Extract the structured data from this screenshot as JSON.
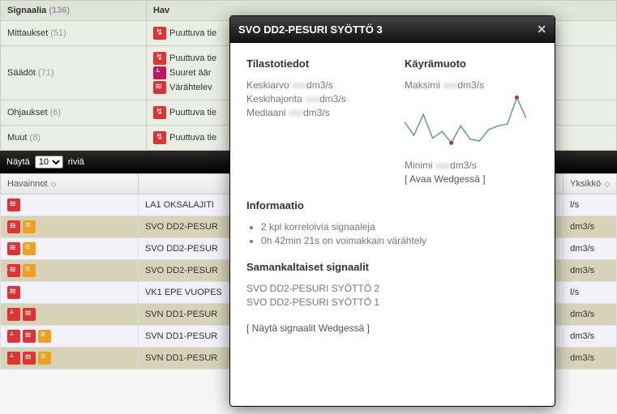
{
  "summary": {
    "header1": "Signaalia",
    "header1_count": "(136)",
    "header2": "Hav",
    "rows": [
      {
        "label": "Mittaukset",
        "count": "(51)",
        "obs": [
          {
            "icon": "warn-red",
            "text": "Puuttuva tie"
          }
        ]
      },
      {
        "label": "Säädöt",
        "count": "(71)",
        "obs": [
          {
            "icon": "warn-red",
            "text": "Puuttuva tie"
          },
          {
            "icon": "pulse-magenta",
            "text": "Suuret äär"
          },
          {
            "icon": "vibrate-red",
            "text": "Värähtelev"
          }
        ]
      },
      {
        "label": "Ohjaukset",
        "count": "(6)",
        "obs": [
          {
            "icon": "warn-red",
            "text": "Puuttuva tie"
          }
        ]
      },
      {
        "label": "Muut",
        "count": "(8)",
        "obs": [
          {
            "icon": "warn-red",
            "text": "Puuttuva tie"
          }
        ]
      }
    ]
  },
  "toolbar": {
    "show_label": "Näytä",
    "rows_label": "riviä",
    "select_value": "10"
  },
  "table": {
    "col_havainnot": "Havainnot",
    "col_yksikko": "Yksikkö",
    "rows": [
      {
        "icons": [
          "vibrate-red"
        ],
        "name": "LA1 OKSALAJITI",
        "unit": "l/s"
      },
      {
        "icons": [
          "vibrate-red",
          "warn-orange"
        ],
        "name": "SVO DD2-PESUR",
        "unit": "dm3/s"
      },
      {
        "icons": [
          "vibrate-red",
          "warn-orange"
        ],
        "name": "SVO DD2-PESUR",
        "unit": "dm3/s"
      },
      {
        "icons": [
          "vibrate-red",
          "warn-orange"
        ],
        "name": "SVO DD2-PESUR",
        "unit": "dm3/s"
      },
      {
        "icons": [
          "vibrate-red"
        ],
        "name": "VK1 EPE VUOPES",
        "unit": "l/s"
      },
      {
        "icons": [
          "pulse-red",
          "vibrate-red"
        ],
        "name": "SVN DD1-PESUR",
        "unit": "dm3/s"
      },
      {
        "icons": [
          "pulse-red",
          "vibrate-red",
          "warn-orange"
        ],
        "name": "SVN DD1-PESUR",
        "unit": "dm3/s"
      },
      {
        "icons": [
          "pulse-red",
          "vibrate-red",
          "warn-orange"
        ],
        "name": "SVN DD1-PESUR",
        "unit": "dm3/s"
      }
    ]
  },
  "modal": {
    "title": "SVO DD2-PESURI SYÖTTÖ 3",
    "stats_heading": "Tilastotiedot",
    "curve_heading": "Käyrämuoto",
    "mean_label": "Keskiarvo",
    "stddev_label": "Keskihajonta",
    "median_label": "Mediaani",
    "unit": "dm3/s",
    "max_label": "Maksimi",
    "min_label": "Minimi",
    "open_wedge": "[ Avaa Wedgessä ]",
    "info_heading": "Informaatio",
    "info_items": [
      "2 kpl korreloivia signaaleja",
      "0h 42min 21s on voimakkain värähtely"
    ],
    "similar_heading": "Samankaltaiset signaalit",
    "similar_items": [
      "SVO DD2-PESURI SYÖTTÖ 2",
      "SVO DD2-PESURI SYÖTTÖ 1"
    ],
    "show_wedge": "[ Näytä signaalit Wedgessä ]"
  },
  "chart_data": {
    "type": "line",
    "title": "",
    "x": [
      0,
      1,
      2,
      3,
      4,
      5,
      6,
      7,
      8,
      9,
      10,
      11,
      12,
      13
    ],
    "values": [
      52,
      38,
      60,
      35,
      42,
      30,
      48,
      34,
      32,
      44,
      48,
      50,
      78,
      56
    ],
    "min_index": 5,
    "max_index": 12,
    "ylim": [
      20,
      80
    ]
  }
}
